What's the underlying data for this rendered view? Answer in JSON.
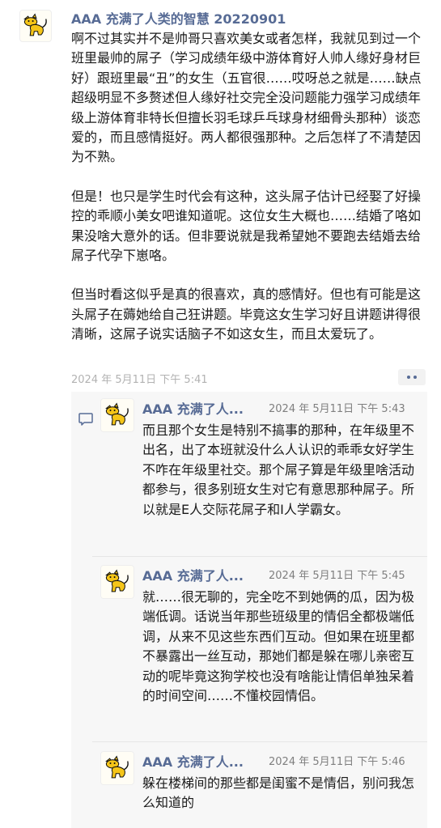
{
  "post": {
    "author": "AAA 充满了人类的智慧 20220901",
    "paragraphs": [
      "啊不过其实并不是帅哥只喜欢美女或者怎样，我就见到过一个班里最帅的屌子（学习成绩年级中游体育好人帅人缘好身材巨好）跟班里最“丑”的女生（五官很……哎呀总之就是……缺点超级明显不多赘述但人缘好社交完全没问题能力强学习成绩年级上游体育非特长但擅长羽毛球乒乓球身材细骨头那种）谈恋爱的，而且感情挺好。两人都很强那种。之后怎样了不清楚因为不熟。",
      "但是！也只是学生时代会有这种，这头屌子估计已经娶了好操控的乖顺小美女吧谁知道呢。这位女生大概也……结婚了咯如果没啥大意外的话。但非要说就是我希望她不要跑去结婚去给屌子代孕下崽咯。",
      "但当时看这似乎是真的很喜欢，真的感情好。但也有可能是这头屌子在薅她给自己狂讲题。毕竟这女生学习好且讲题讲得很清晰，这屌子说实话脑子不如这女生，而且太爱玩了。"
    ],
    "time": "2024 年 5月11日 下午 5:41"
  },
  "comments": [
    {
      "author": "AAA 充满了人...",
      "time": "2024 年 5月11日 下午 5:43",
      "text": "而且那个女生是特别不搞事的那种，在年级里不出名，出了本班就没什么人认识的乖乖女好学生不咋在年级里社交。那个屌子算是年级里啥活动都参与，很多别班女生对它有意思那种屌子。所以就是E人交际花屌子和I人学霸女。"
    },
    {
      "author": "AAA 充满了人...",
      "time": "2024 年 5月11日 下午 5:45",
      "text": "就……很无聊的，完全吃不到她俩的瓜，因为极端低调。话说当年那些班级里的情侣全都极端低调，从来不见这些东西们互动。但如果在班里都不暴露出一丝互动，那她们都是躲在哪儿亲密互动的呢毕竟这狗学校也没有啥能让情侣单独呆着的时间空间……不懂校园情侣。"
    },
    {
      "author": "AAA 充满了人...",
      "time": "2024 年 5月11日 下午 5:46",
      "text": "躲在楼梯间的那些都是闺蜜不是情侣，别问我怎么知道的"
    }
  ],
  "icons": {
    "avatar": "yellow-cat-icon",
    "comment": "comment-bubble-icon",
    "more": "more-dots-icon"
  },
  "colors": {
    "name": "#576b95",
    "text": "#1a1a1a",
    "time": "#b2b2b2",
    "comment_bg": "#f7f7f7"
  }
}
